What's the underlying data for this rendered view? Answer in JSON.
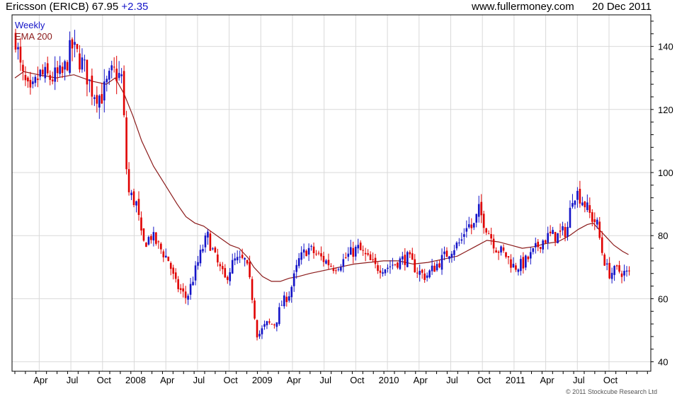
{
  "header": {
    "ticker": "Ericsson (ERICB)",
    "price": "67.95",
    "change": "+2.35",
    "site": "www.fullermoney.com",
    "date": "20 Dec 2011"
  },
  "legend": {
    "weekly": "Weekly",
    "ema": "EMA 200"
  },
  "copyright": "© 2011 Stockcube Research Ltd",
  "colors": {
    "up": "#1414c8",
    "down": "#e00000",
    "ema": "#8b1a1a",
    "grid": "#d9d9d9",
    "frame": "#000000",
    "change": "#1414c8"
  },
  "chart_data": {
    "type": "candlestick",
    "title": "Ericsson (ERICB)",
    "frequency": "Weekly",
    "y_axis_side": "right",
    "ylim": [
      37,
      150
    ],
    "yticks": [
      40,
      60,
      80,
      100,
      120,
      140
    ],
    "xlim": [
      0,
      208
    ],
    "xticks": [
      {
        "label": "Apr",
        "x": 10
      },
      {
        "label": "Jul",
        "x": 23
      },
      {
        "label": "Oct",
        "x": 36
      },
      {
        "label": "2008",
        "x": 49
      },
      {
        "label": "Apr",
        "x": 62
      },
      {
        "label": "Jul",
        "x": 75
      },
      {
        "label": "Oct",
        "x": 88
      },
      {
        "label": "2009",
        "x": 101
      },
      {
        "label": "Apr",
        "x": 114
      },
      {
        "label": "Jul",
        "x": 127
      },
      {
        "label": "Oct",
        "x": 140
      },
      {
        "label": "2010",
        "x": 153
      },
      {
        "label": "Apr",
        "x": 166
      },
      {
        "label": "Jul",
        "x": 179
      },
      {
        "label": "Oct",
        "x": 192
      },
      {
        "label": "2011",
        "x": 205
      },
      {
        "label": "Apr",
        "x": 218
      },
      {
        "label": "Jul",
        "x": 231
      },
      {
        "label": "Oct",
        "x": 244
      }
    ],
    "series": [
      {
        "name": "Weekly",
        "keypoints_close": [
          [
            0,
            143
          ],
          [
            2,
            131
          ],
          [
            5,
            124
          ],
          [
            8,
            131
          ],
          [
            12,
            130
          ],
          [
            16,
            131
          ],
          [
            19,
            140
          ],
          [
            23,
            134
          ],
          [
            26,
            126
          ],
          [
            29,
            124
          ],
          [
            33,
            132
          ],
          [
            36,
            130
          ],
          [
            38,
            94
          ],
          [
            41,
            90
          ],
          [
            43,
            77
          ],
          [
            46,
            80
          ],
          [
            49,
            76
          ],
          [
            52,
            72
          ],
          [
            54,
            65
          ],
          [
            58,
            60
          ],
          [
            60,
            66
          ],
          [
            63,
            75
          ],
          [
            65,
            80
          ],
          [
            68,
            72
          ],
          [
            71,
            66
          ],
          [
            74,
            72
          ],
          [
            78,
            72
          ],
          [
            80,
            62
          ],
          [
            82,
            48
          ],
          [
            85,
            52
          ],
          [
            88,
            52
          ],
          [
            90,
            58
          ],
          [
            93,
            62
          ],
          [
            96,
            72
          ],
          [
            99,
            76
          ],
          [
            102,
            74
          ],
          [
            105,
            72
          ],
          [
            108,
            70
          ],
          [
            111,
            72
          ],
          [
            113,
            74
          ],
          [
            116,
            76
          ],
          [
            119,
            73
          ],
          [
            122,
            70
          ],
          [
            126,
            70
          ],
          [
            130,
            72
          ],
          [
            133,
            73
          ],
          [
            136,
            69
          ],
          [
            139,
            67
          ],
          [
            142,
            70
          ],
          [
            145,
            73
          ],
          [
            148,
            76
          ],
          [
            151,
            78
          ],
          [
            153,
            84
          ],
          [
            155,
            82
          ],
          [
            157,
            88
          ],
          [
            160,
            82
          ],
          [
            163,
            76
          ],
          [
            166,
            74
          ],
          [
            169,
            70
          ],
          [
            172,
            71
          ],
          [
            175,
            74
          ],
          [
            178,
            78
          ],
          [
            181,
            80
          ],
          [
            184,
            80
          ],
          [
            187,
            82
          ],
          [
            189,
            94
          ],
          [
            191,
            93
          ],
          [
            193,
            90
          ],
          [
            195,
            86
          ],
          [
            197,
            84
          ],
          [
            199,
            74
          ],
          [
            201,
            68
          ],
          [
            204,
            69
          ],
          [
            207,
            68
          ],
          [
            208,
            68
          ]
        ],
        "close_range": [
          41,
          145
        ]
      },
      {
        "name": "EMA 200",
        "points": [
          [
            0,
            130
          ],
          [
            3,
            132
          ],
          [
            8,
            131
          ],
          [
            14,
            130
          ],
          [
            20,
            131
          ],
          [
            26,
            129
          ],
          [
            31,
            128
          ],
          [
            34,
            130
          ],
          [
            37,
            125
          ],
          [
            40,
            118
          ],
          [
            43,
            110
          ],
          [
            47,
            102
          ],
          [
            51,
            96
          ],
          [
            55,
            90
          ],
          [
            58,
            86
          ],
          [
            61,
            84
          ],
          [
            64,
            83
          ],
          [
            67,
            81
          ],
          [
            70,
            79
          ],
          [
            73,
            77
          ],
          [
            76,
            76
          ],
          [
            79,
            73
          ],
          [
            81,
            70
          ],
          [
            84,
            67
          ],
          [
            87,
            65.5
          ],
          [
            90,
            65.5
          ],
          [
            93,
            66.5
          ],
          [
            96,
            67
          ],
          [
            100,
            68
          ],
          [
            105,
            69
          ],
          [
            110,
            70
          ],
          [
            115,
            71
          ],
          [
            120,
            71.5
          ],
          [
            125,
            72
          ],
          [
            130,
            72
          ],
          [
            135,
            71
          ],
          [
            140,
            71.5
          ],
          [
            145,
            72.5
          ],
          [
            150,
            73.5
          ],
          [
            153,
            75
          ],
          [
            156,
            76.5
          ],
          [
            160,
            78.5
          ],
          [
            164,
            78
          ],
          [
            168,
            77
          ],
          [
            172,
            76
          ],
          [
            176,
            76.5
          ],
          [
            180,
            77.5
          ],
          [
            184,
            78
          ],
          [
            188,
            80
          ],
          [
            191,
            82
          ],
          [
            194,
            83.5
          ],
          [
            196,
            84
          ],
          [
            198,
            82
          ],
          [
            200,
            80
          ],
          [
            203,
            77
          ],
          [
            206,
            75
          ],
          [
            208,
            74
          ]
        ]
      }
    ]
  }
}
